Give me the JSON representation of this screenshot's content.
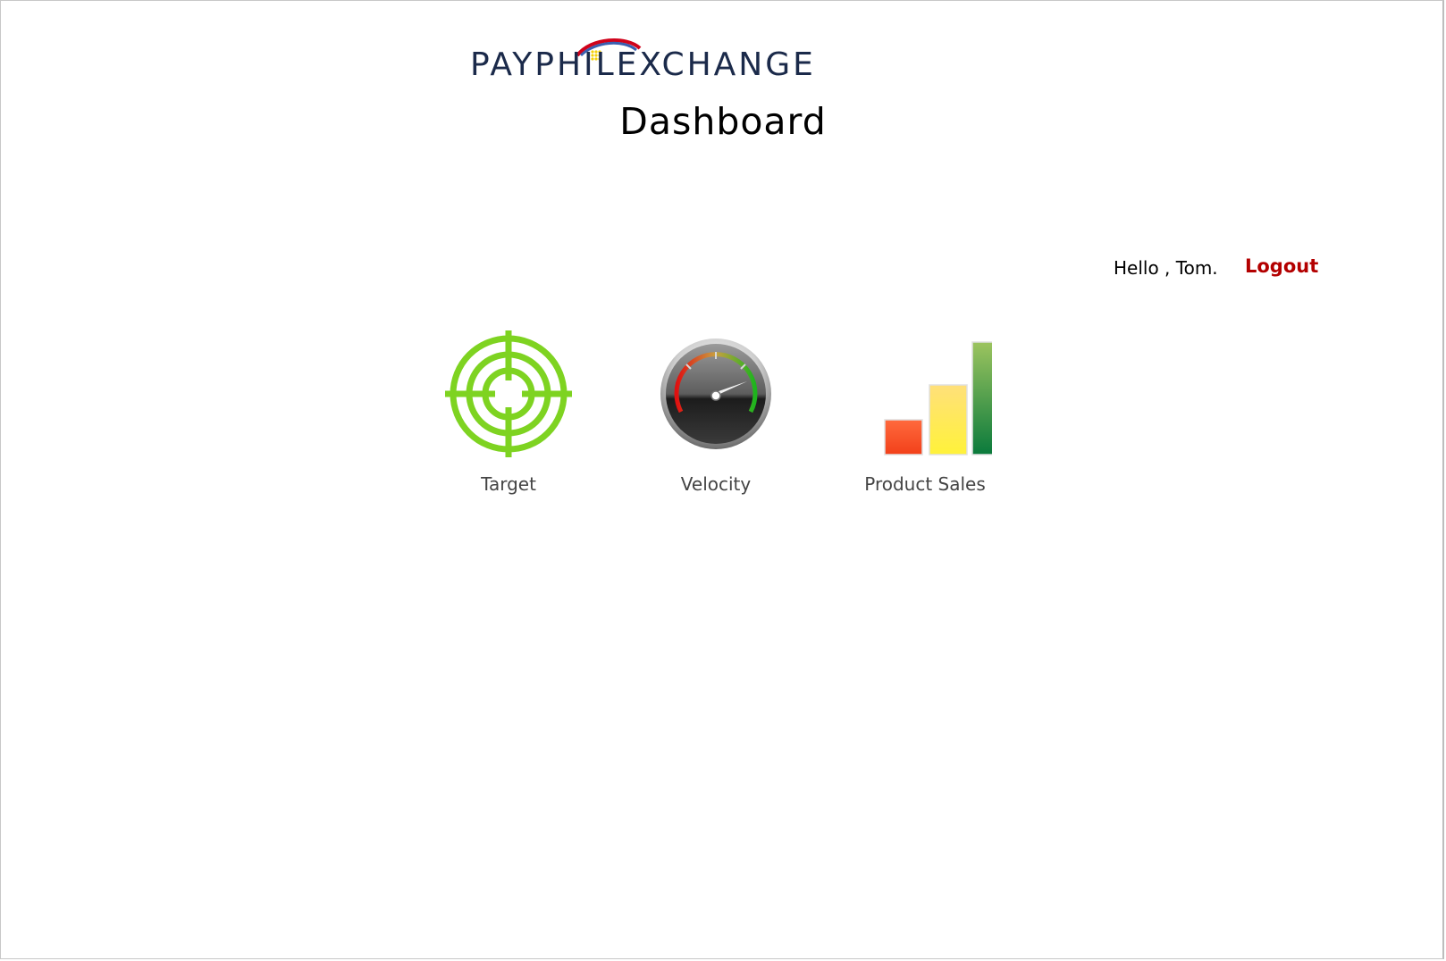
{
  "header": {
    "logo_text": "PAYPHILEXCHANGE",
    "page_title": "Dashboard"
  },
  "user": {
    "greeting": "Hello , Tom.",
    "logout_label": "Logout"
  },
  "tiles": [
    {
      "label": "Target",
      "icon": "target-icon",
      "color": "#7ed321"
    },
    {
      "label": "Velocity",
      "icon": "speedometer-icon"
    },
    {
      "label": "Product Sales",
      "icon": "bar-chart-icon"
    }
  ],
  "colors": {
    "logo_navy": "#1b2a4a",
    "logo_red": "#d0021b",
    "logo_blue": "#3a5fb0",
    "logo_yellow": "#f5d10a",
    "logout": "#b30000",
    "target_green": "#7ed321",
    "bar_red": "#f4511e",
    "bar_yellow": "#ffe14d",
    "bar_green": "#1e8a4a"
  }
}
